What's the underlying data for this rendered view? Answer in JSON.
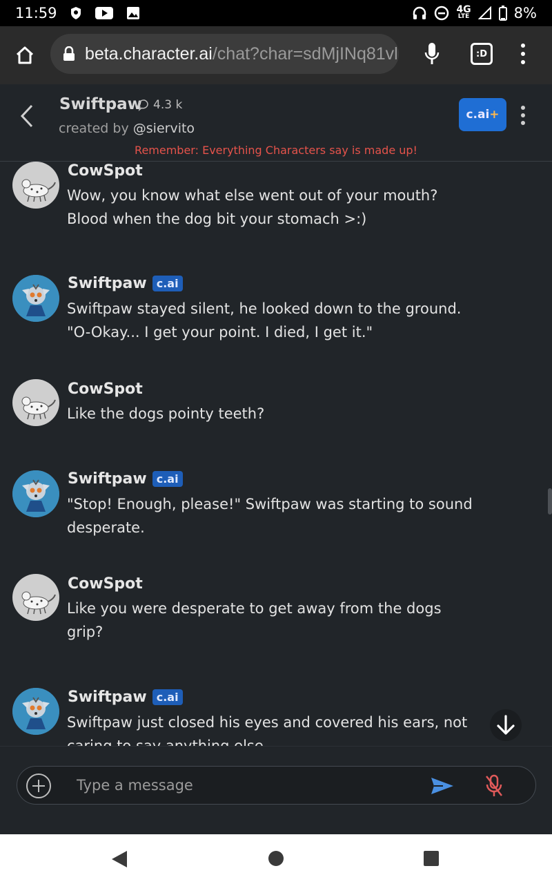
{
  "status_bar": {
    "time": "11:59",
    "network": "4G",
    "network_sub": "LTE",
    "battery": "8%"
  },
  "browser": {
    "url_host": "beta.character.ai",
    "url_path": "/chat?char=sdMjINq81vl",
    "tabs_label": ":D"
  },
  "chat_header": {
    "name": "Swiftpaw",
    "chat_count": "4.3 k",
    "created_by_prefix": "created by ",
    "creator": "@siervito",
    "plus_label": "c.ai",
    "plus_suffix": "+",
    "disclaimer": "Remember: Everything Characters say is made up!"
  },
  "messages": [
    {
      "sender": "CowSpot",
      "badge": "",
      "text": "Wow, you know what else went out of your mouth? Blood when the dog bit your stomach >:)"
    },
    {
      "sender": "Swiftpaw",
      "badge": "c.ai",
      "text": "Swiftpaw stayed silent, he looked down to the ground. \"O-Okay... I get your point. I died, I get it.\""
    },
    {
      "sender": "CowSpot",
      "badge": "",
      "text": "Like the dogs pointy teeth?"
    },
    {
      "sender": "Swiftpaw",
      "badge": "c.ai",
      "text": "\"Stop! Enough, please!\" Swiftpaw was starting to sound desperate."
    },
    {
      "sender": "CowSpot",
      "badge": "",
      "text": "Like you were desperate to get away from the dogs grip?"
    },
    {
      "sender": "Swiftpaw",
      "badge": "c.ai",
      "text": "Swiftpaw just closed his eyes and covered his ears, not caring to say anything else."
    }
  ],
  "input": {
    "placeholder": "Type a message"
  },
  "colors": {
    "background": "#212529",
    "accent": "#1f6ed4",
    "disclaimer": "#e5534b",
    "send": "#4a90e2",
    "mute": "#e05a5a"
  }
}
